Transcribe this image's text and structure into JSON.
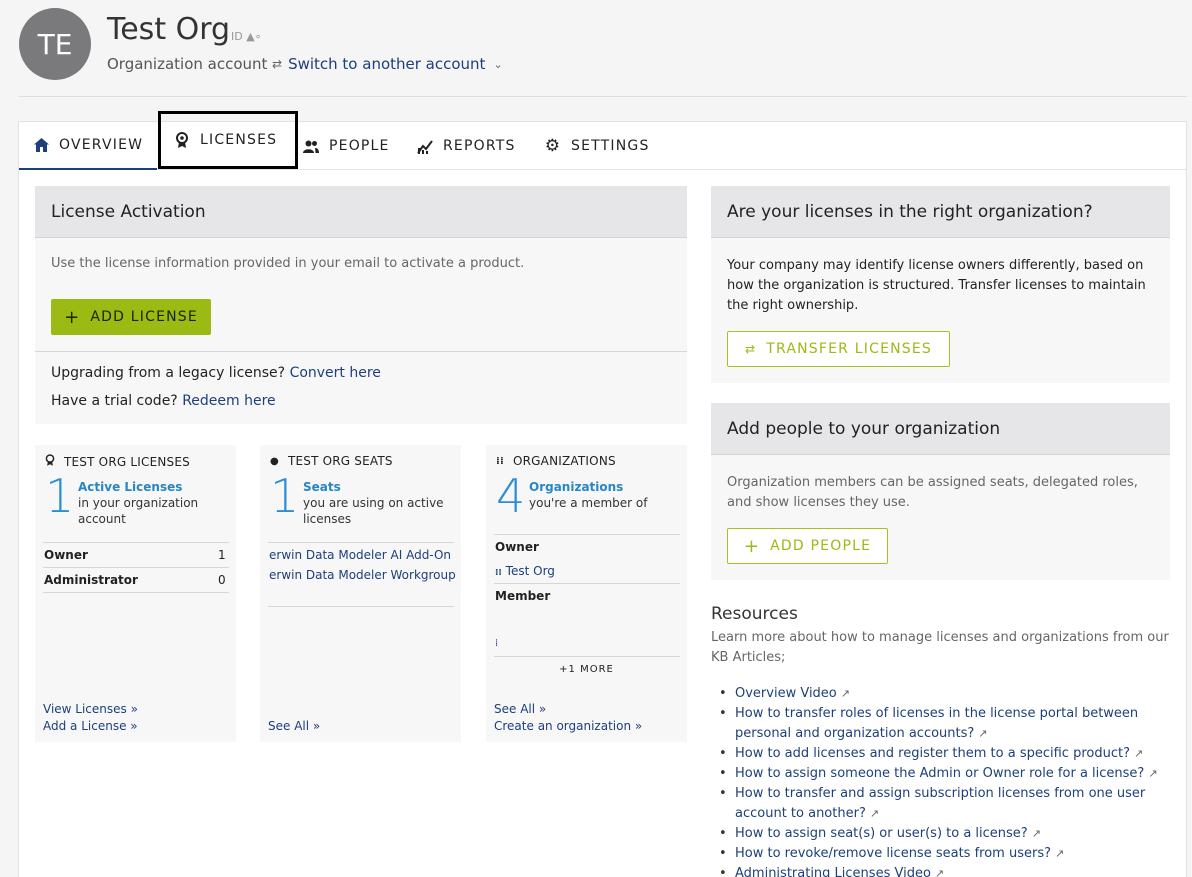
{
  "header": {
    "avatar_initials": "TE",
    "org_name": "Test Org",
    "org_id_label": "ID",
    "account_type": "Organization account",
    "switch_label": "Switch to another account"
  },
  "tabs": [
    {
      "label": "OVERVIEW",
      "icon": "home-icon"
    },
    {
      "label": "LICENSES",
      "icon": "badge-icon"
    },
    {
      "label": "PEOPLE",
      "icon": "people-icon"
    },
    {
      "label": "REPORTS",
      "icon": "chart-icon"
    },
    {
      "label": "SETTINGS",
      "icon": "gear-icon"
    }
  ],
  "activation": {
    "title": "License Activation",
    "desc": "Use the license information provided in your email to activate a product.",
    "add_button": "ADD LICENSE",
    "legacy_text": "Upgrading from a legacy license?",
    "legacy_link": "Convert here",
    "trial_text": "Have a trial code?",
    "trial_link": "Redeem here"
  },
  "licenses_card": {
    "title": "TEST ORG LICENSES",
    "count": "1",
    "label": "Active Licenses",
    "desc": "in your organization account",
    "rows": [
      {
        "role": "Owner",
        "count": "1"
      },
      {
        "role": "Administrator",
        "count": "0"
      }
    ],
    "view_link": "View Licenses",
    "add_link": "Add a License"
  },
  "seats_card": {
    "title": "TEST ORG SEATS",
    "count": "1",
    "label": "Seats",
    "desc": "you are using on active licenses",
    "products": [
      "erwin Data Modeler AI Add-On",
      "erwin Data Modeler Workgroup"
    ],
    "see_all": "See All"
  },
  "orgs_card": {
    "title": "ORGANIZATIONS",
    "count": "4",
    "label": "Organizations",
    "desc": "you're a member of",
    "owner_label": "Owner",
    "owner_org": "Test Org",
    "member_label": "Member",
    "more": "+1 MORE",
    "see_all": "See All",
    "create_link": "Create an organization"
  },
  "transfer": {
    "title": "Are your licenses in the right organization?",
    "desc": "Your company may identify license owners differently, based on how the organization is structured. Transfer licenses to maintain the right ownership.",
    "button": "TRANSFER LICENSES"
  },
  "people": {
    "title": "Add people to your organization",
    "desc": "Organization members can be assigned seats, delegated roles, and show licenses they use.",
    "button": "ADD PEOPLE"
  },
  "resources": {
    "title": "Resources",
    "desc": "Learn more about how to manage licenses and organizations from our KB Articles;",
    "items": [
      "Overview Video",
      "How to transfer roles of licenses in the license portal between personal and organization accounts?",
      "How to add licenses and register them to a specific product?",
      "How to assign someone the Admin or Owner role for a license?",
      "How to transfer and assign subscription licenses from one user account to another?",
      "How to assign seat(s) or user(s) to a license?",
      "How to revoke/remove license seats from users?",
      "Administrating Licenses Video"
    ]
  },
  "colors": {
    "accent_green": "#9bba14",
    "link_blue": "#1d3f7a",
    "number_blue": "#2d8fd1"
  }
}
